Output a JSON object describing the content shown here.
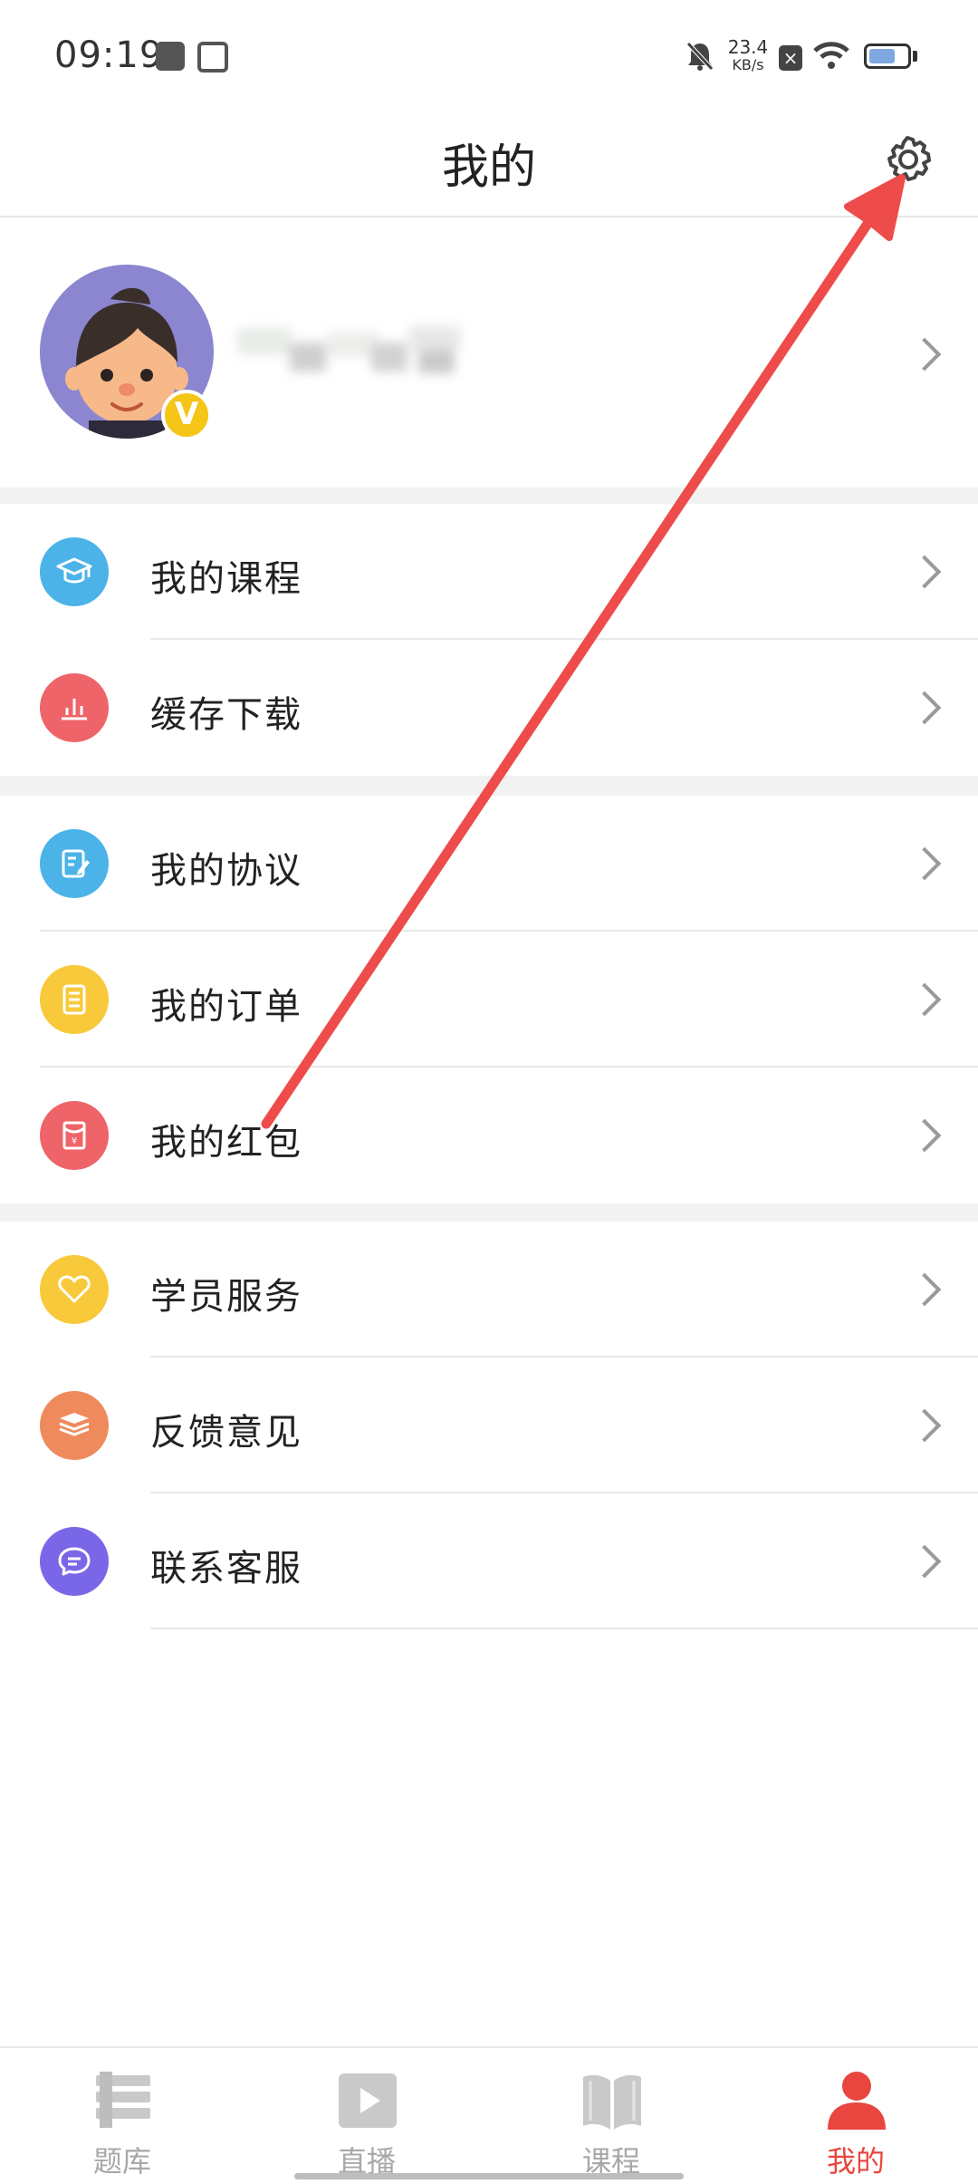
{
  "status_bar": {
    "time": "09:19",
    "net_speed_value": "23.4",
    "net_speed_unit": "KB/s",
    "battery_level": 0.7
  },
  "header": {
    "title": "我的",
    "settings_icon": "gear-icon"
  },
  "profile": {
    "badge": "V",
    "avatar_icon": "cartoon-boy-avatar"
  },
  "menu_groups": [
    {
      "items": [
        {
          "label": "我的课程",
          "icon": "graduation-cap-icon",
          "color": "#4bb3e8"
        },
        {
          "label": "缓存下载",
          "icon": "bar-chart-icon",
          "color": "#ee6468"
        }
      ]
    },
    {
      "items": [
        {
          "label": "我的协议",
          "icon": "document-edit-icon",
          "color": "#4bb3e8"
        },
        {
          "label": "我的订单",
          "icon": "list-icon",
          "color": "#f8c93a"
        },
        {
          "label": "我的红包",
          "icon": "red-envelope-icon",
          "color": "#ee6468"
        }
      ]
    },
    {
      "items": [
        {
          "label": "学员服务",
          "icon": "heart-icon",
          "color": "#f8c93a"
        },
        {
          "label": "反馈意见",
          "icon": "stack-icon",
          "color": "#ef8a5c"
        },
        {
          "label": "联系客服",
          "icon": "chat-bubble-icon",
          "color": "#7a67e8"
        }
      ]
    }
  ],
  "bottom_nav": {
    "items": [
      {
        "label": "题库",
        "icon": "question-bank-icon"
      },
      {
        "label": "直播",
        "icon": "play-icon"
      },
      {
        "label": "课程",
        "icon": "book-icon"
      },
      {
        "label": "我的",
        "icon": "user-icon",
        "active": true
      }
    ],
    "active_color": "#e8463f",
    "inactive_color": "#a8a8a8"
  },
  "annotation": {
    "color": "#ee4b4b",
    "points_to": "settings-button"
  }
}
